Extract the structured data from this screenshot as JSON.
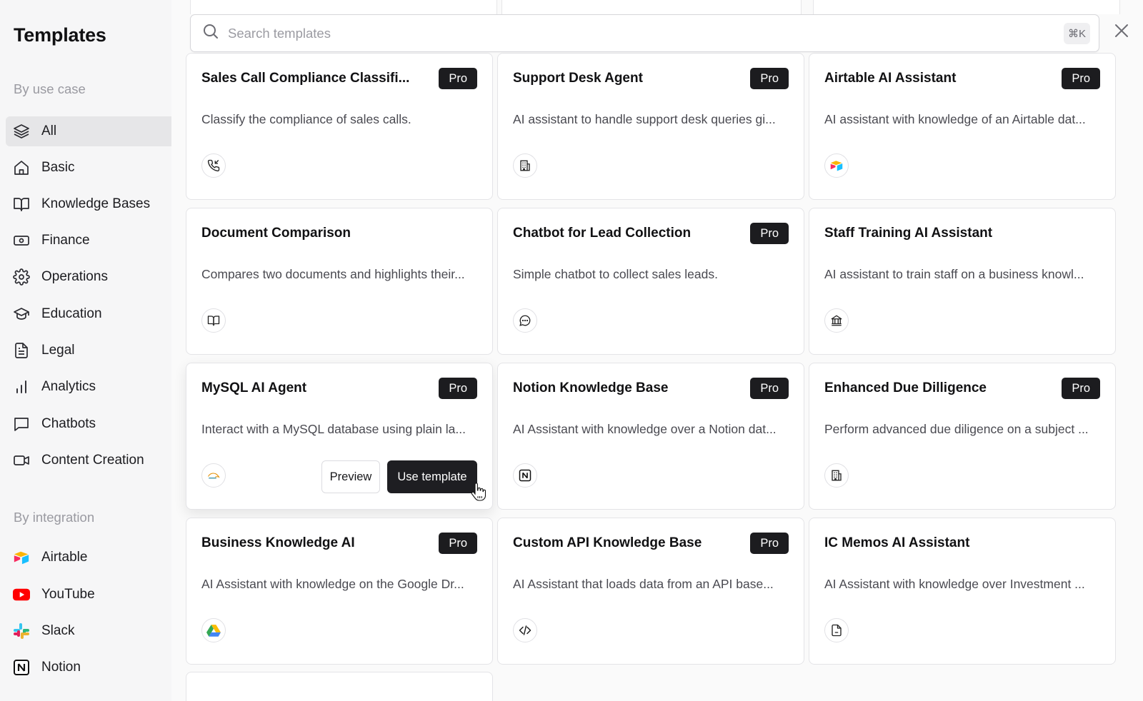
{
  "sidebar": {
    "title": "Templates",
    "use_case_heading": "By use case",
    "use_cases": [
      {
        "label": "All",
        "icon": "layers-icon"
      },
      {
        "label": "Basic",
        "icon": "home-icon"
      },
      {
        "label": "Knowledge Bases",
        "icon": "book-open-icon"
      },
      {
        "label": "Finance",
        "icon": "banknote-icon"
      },
      {
        "label": "Operations",
        "icon": "gear-icon"
      },
      {
        "label": "Education",
        "icon": "graduation-cap-icon"
      },
      {
        "label": "Legal",
        "icon": "document-icon"
      },
      {
        "label": "Analytics",
        "icon": "bar-chart-icon"
      },
      {
        "label": "Chatbots",
        "icon": "chat-bubble-icon"
      },
      {
        "label": "Content Creation",
        "icon": "video-camera-icon"
      }
    ],
    "active_use_case": "All",
    "integration_heading": "By integration",
    "integrations": [
      {
        "label": "Airtable",
        "icon": "airtable-logo-icon"
      },
      {
        "label": "YouTube",
        "icon": "youtube-logo-icon"
      },
      {
        "label": "Slack",
        "icon": "slack-logo-icon"
      },
      {
        "label": "Notion",
        "icon": "notion-logo-icon"
      }
    ]
  },
  "search": {
    "placeholder": "Search templates",
    "value": "",
    "shortcut": "⌘K"
  },
  "pro_label": "Pro",
  "cards": [
    {
      "title": "Sales Call Compliance Classifi...",
      "pro": true,
      "description": "Classify the compliance of sales calls.",
      "icon": "phone-call-icon"
    },
    {
      "title": "Support Desk Agent",
      "pro": true,
      "description": "AI assistant to handle support desk queries gi...",
      "icon": "building-icon"
    },
    {
      "title": "Airtable AI Assistant",
      "pro": true,
      "description": "AI assistant with knowledge of an Airtable dat...",
      "icon": "airtable-logo-icon"
    },
    {
      "title": "Document Comparison",
      "pro": false,
      "description": "Compares two documents and highlights their...",
      "icon": "book-open-icon"
    },
    {
      "title": "Chatbot for Lead Collection",
      "pro": true,
      "description": "Simple chatbot to collect sales leads.",
      "icon": "chat-dots-icon"
    },
    {
      "title": "Staff Training AI Assistant",
      "pro": false,
      "description": "AI assistant to train staff on a business knowl...",
      "icon": "institution-icon"
    },
    {
      "title": "MySQL AI Agent",
      "pro": true,
      "description": "Interact with a MySQL database using plain la...",
      "icon": "mysql-logo-icon"
    },
    {
      "title": "Notion Knowledge Base",
      "pro": true,
      "description": "AI Assistant with knowledge over a Notion dat...",
      "icon": "notion-logo-icon"
    },
    {
      "title": "Enhanced Due Dilligence",
      "pro": true,
      "description": "Perform advanced due diligence on a subject ...",
      "icon": "building-icon"
    },
    {
      "title": "Business Knowledge AI",
      "pro": true,
      "description": "AI Assistant with knowledge on the Google Dr...",
      "icon": "google-drive-logo-icon"
    },
    {
      "title": "Custom API Knowledge Base",
      "pro": true,
      "description": "AI Assistant that loads data from an API base...",
      "icon": "code-icon"
    },
    {
      "title": "IC Memos AI Assistant",
      "pro": false,
      "description": "AI Assistant with knowledge over Investment ...",
      "icon": "file-icon"
    }
  ],
  "hovered_card": "MySQL AI Agent",
  "card_actions": {
    "preview_label": "Preview",
    "use_label": "Use template"
  }
}
